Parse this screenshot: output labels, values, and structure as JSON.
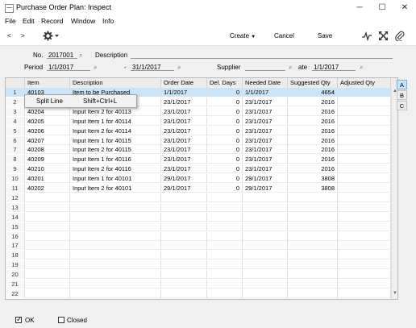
{
  "window": {
    "title": "Purchase Order Plan: Inspect",
    "minimize": "─",
    "maximize": "☐",
    "close": "✕"
  },
  "menu": [
    "File",
    "Edit",
    "Record",
    "Window",
    "Info"
  ],
  "toolbar": {
    "back": "<",
    "forward": ">",
    "create_label": "Create",
    "cancel_label": "Cancel",
    "save_label": "Save"
  },
  "header": {
    "no_label": "No.",
    "no_value": "2017001",
    "description_label": "Description",
    "description_value": "",
    "period_label": "Period",
    "period_from": "1/1/2017",
    "period_sep": "-",
    "period_to": "31/1/2017",
    "supplier_label": "Supplier",
    "supplier_value": "",
    "date_label": "ate",
    "date_value": "1/1/2017"
  },
  "grid": {
    "columns": [
      "",
      "Item",
      "Description",
      "Order Date",
      "Del. Days",
      "Needed Date",
      "Suggested Qty",
      "Adjusted Qty"
    ],
    "rows": [
      [
        "1",
        "40103",
        "Item to be Purchased",
        "1/1/2017",
        "0",
        "1/1/2017",
        "4654",
        ""
      ],
      [
        "2",
        "",
        "",
        "23/1/2017",
        "0",
        "23/1/2017",
        "2016",
        ""
      ],
      [
        "3",
        "40204",
        "Input Item 2 for 40113",
        "23/1/2017",
        "0",
        "23/1/2017",
        "2016",
        ""
      ],
      [
        "4",
        "40205",
        "Input Item 1 for 40114",
        "23/1/2017",
        "0",
        "23/1/2017",
        "2016",
        ""
      ],
      [
        "5",
        "40206",
        "Input Item 2 for 40114",
        "23/1/2017",
        "0",
        "23/1/2017",
        "2016",
        ""
      ],
      [
        "6",
        "40207",
        "Input Item 1 for 40115",
        "23/1/2017",
        "0",
        "23/1/2017",
        "2016",
        ""
      ],
      [
        "7",
        "40208",
        "Input Item 2 for 40115",
        "23/1/2017",
        "0",
        "23/1/2017",
        "2016",
        ""
      ],
      [
        "8",
        "40209",
        "Input Item 1 for 40116",
        "23/1/2017",
        "0",
        "23/1/2017",
        "2016",
        ""
      ],
      [
        "9",
        "40210",
        "Input Item 2 for 40116",
        "23/1/2017",
        "0",
        "23/1/2017",
        "2016",
        ""
      ],
      [
        "10",
        "40201",
        "Input Item 1 for 40101",
        "29/1/2017",
        "0",
        "29/1/2017",
        "3808",
        ""
      ],
      [
        "11",
        "40202",
        "Input Item 2 for 40101",
        "29/1/2017",
        "0",
        "29/1/2017",
        "3808",
        ""
      ],
      [
        "12",
        "",
        "",
        "",
        "",
        "",
        "",
        ""
      ],
      [
        "13",
        "",
        "",
        "",
        "",
        "",
        "",
        ""
      ],
      [
        "14",
        "",
        "",
        "",
        "",
        "",
        "",
        ""
      ],
      [
        "15",
        "",
        "",
        "",
        "",
        "",
        "",
        ""
      ],
      [
        "16",
        "",
        "",
        "",
        "",
        "",
        "",
        ""
      ],
      [
        "17",
        "",
        "",
        "",
        "",
        "",
        "",
        ""
      ],
      [
        "18",
        "",
        "",
        "",
        "",
        "",
        "",
        ""
      ],
      [
        "19",
        "",
        "",
        "",
        "",
        "",
        "",
        ""
      ],
      [
        "20",
        "",
        "",
        "",
        "",
        "",
        "",
        ""
      ],
      [
        "21",
        "",
        "",
        "",
        "",
        "",
        "",
        ""
      ],
      [
        "22",
        "",
        "",
        "",
        "",
        "",
        "",
        ""
      ]
    ],
    "tabs": [
      "A",
      "B",
      "C"
    ]
  },
  "context_menu": {
    "item_label": "Split Line",
    "shortcut": "Shift+Ctrl+L"
  },
  "footer": {
    "ok_label": "OK",
    "ok_checked": true,
    "closed_label": "Closed",
    "closed_checked": false
  },
  "colors": {
    "selection": "#cce4f7",
    "background": "#f0f0f0"
  }
}
